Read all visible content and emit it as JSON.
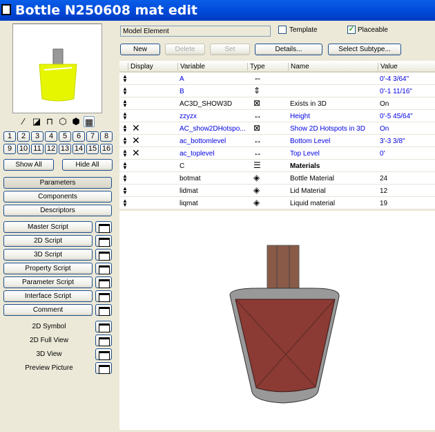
{
  "title": "Bottle  N250608 mat edit",
  "left": {
    "view_icons": [
      "2d-line-icon",
      "2d-box-icon",
      "section-icon",
      "3d-wire-icon",
      "3d-solid-icon",
      "filmstrip-icon"
    ],
    "numbers": [
      "1",
      "2",
      "3",
      "4",
      "5",
      "6",
      "7",
      "8",
      "9",
      "10",
      "11",
      "12",
      "13",
      "14",
      "15",
      "16"
    ],
    "show_all": "Show All",
    "hide_all": "Hide All",
    "sections": [
      "Parameters",
      "Components",
      "Descriptors"
    ],
    "scripts": [
      "Master Script",
      "2D Script",
      "3D Script",
      "Property Script",
      "Parameter Script",
      "Interface Script",
      "Comment"
    ],
    "views": [
      "2D Symbol",
      "2D Full View",
      "3D View",
      "Preview Picture"
    ]
  },
  "top": {
    "subtype": "Model Element",
    "template": "Template",
    "template_checked": false,
    "placeable": "Placeable",
    "placeable_checked": true,
    "new": "New",
    "delete": "Delete",
    "set": "Set",
    "details": "Details...",
    "select_subtype": "Select Subtype..."
  },
  "table": {
    "headers": [
      "Display",
      "Variable",
      "Type",
      "Name",
      "Value"
    ],
    "rows": [
      {
        "display": "",
        "var": "A",
        "type": "⇔",
        "name": "",
        "value": "0'-4 3/64\"",
        "blue": true
      },
      {
        "display": "",
        "var": "B",
        "type": "⇕",
        "name": "",
        "value": "0'-1 11/16\"",
        "blue": true
      },
      {
        "display": "",
        "var": "AC3D_SHOW3D",
        "type": "⊠",
        "name": "Exists in 3D",
        "value": "On",
        "blue": false
      },
      {
        "display": "",
        "var": "zzyzx",
        "type": "↔",
        "name": "Height",
        "value": "0'-5 45/64\"",
        "blue": true
      },
      {
        "display": "✕",
        "var": "AC_show2DHotspo...",
        "type": "⊠",
        "name": "Show 2D Hotspots in 3D",
        "value": "On",
        "blue": true
      },
      {
        "display": "✕",
        "var": "ac_bottomlevel",
        "type": "↔",
        "name": "Bottom Level",
        "value": "3'-3 3/8\"",
        "blue": true
      },
      {
        "display": "✕",
        "var": "ac_toplevel",
        "type": "↔",
        "name": "Top Level",
        "value": "0'",
        "blue": true
      },
      {
        "display": "",
        "var": "C",
        "type": "☰",
        "name": "Materials",
        "value": "",
        "blue": false,
        "bold": true
      },
      {
        "display": "",
        "var": "botmat",
        "type": "◈",
        "name": "Bottle Material",
        "value": "24",
        "blue": false
      },
      {
        "display": "",
        "var": "lidmat",
        "type": "◈",
        "name": "Lid Material",
        "value": "12",
        "blue": false
      },
      {
        "display": "",
        "var": "liqmat",
        "type": "◈",
        "name": "Liquid material",
        "value": "19",
        "blue": false
      }
    ]
  }
}
